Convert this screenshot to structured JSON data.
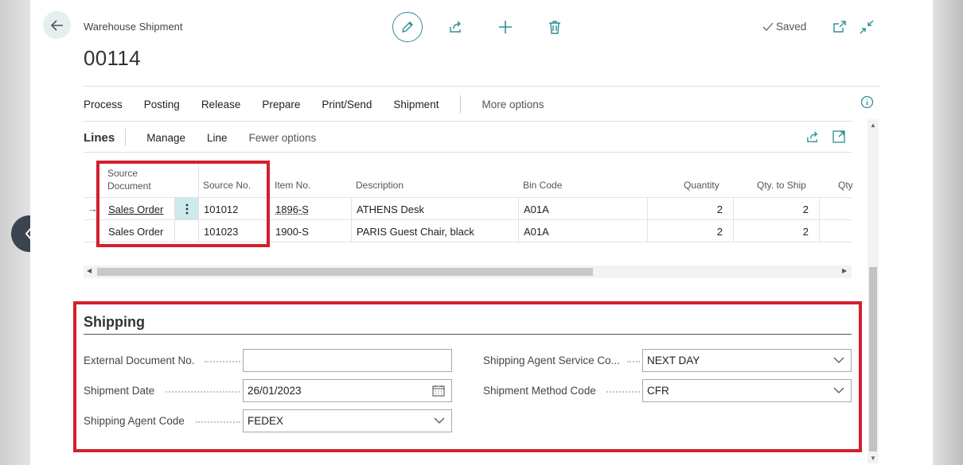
{
  "header": {
    "doc_type": "Warehouse Shipment",
    "doc_no": "00114",
    "saved_label": "Saved"
  },
  "actions": [
    "Process",
    "Posting",
    "Release",
    "Prepare",
    "Print/Send",
    "Shipment"
  ],
  "more_options": "More options",
  "lines": {
    "title": "Lines",
    "actions": [
      "Manage",
      "Line"
    ],
    "fewer_options": "Fewer options",
    "columns": {
      "source_document_1": "Source",
      "source_document_2": "Document",
      "source_no": "Source No.",
      "item_no": "Item No.",
      "description": "Description",
      "bin_code": "Bin Code",
      "quantity": "Quantity",
      "qty_to_ship": "Qty. to Ship",
      "qty_partial": "Qty"
    },
    "rows": [
      {
        "source_document": "Sales Order",
        "source_no": "101012",
        "item_no": "1896-S",
        "description": "ATHENS Desk",
        "bin_code": "A01A",
        "quantity": "2",
        "qty_to_ship": "2"
      },
      {
        "source_document": "Sales Order",
        "source_no": "101023",
        "item_no": "1900-S",
        "description": "PARIS Guest Chair, black",
        "bin_code": "A01A",
        "quantity": "2",
        "qty_to_ship": "2"
      }
    ]
  },
  "shipping": {
    "title": "Shipping",
    "external_document_no": {
      "label": "External Document No.",
      "value": ""
    },
    "shipment_date": {
      "label": "Shipment Date",
      "value": "26/01/2023"
    },
    "shipping_agent_code": {
      "label": "Shipping Agent Code",
      "value": "FEDEX"
    },
    "shipping_agent_service_code": {
      "label": "Shipping Agent Service Co...",
      "value": "NEXT DAY"
    },
    "shipment_method_code": {
      "label": "Shipment Method Code",
      "value": "CFR"
    }
  },
  "colors": {
    "accent": "#2c8f96",
    "highlight": "#d3202e",
    "nav_button": "#3b4552"
  }
}
